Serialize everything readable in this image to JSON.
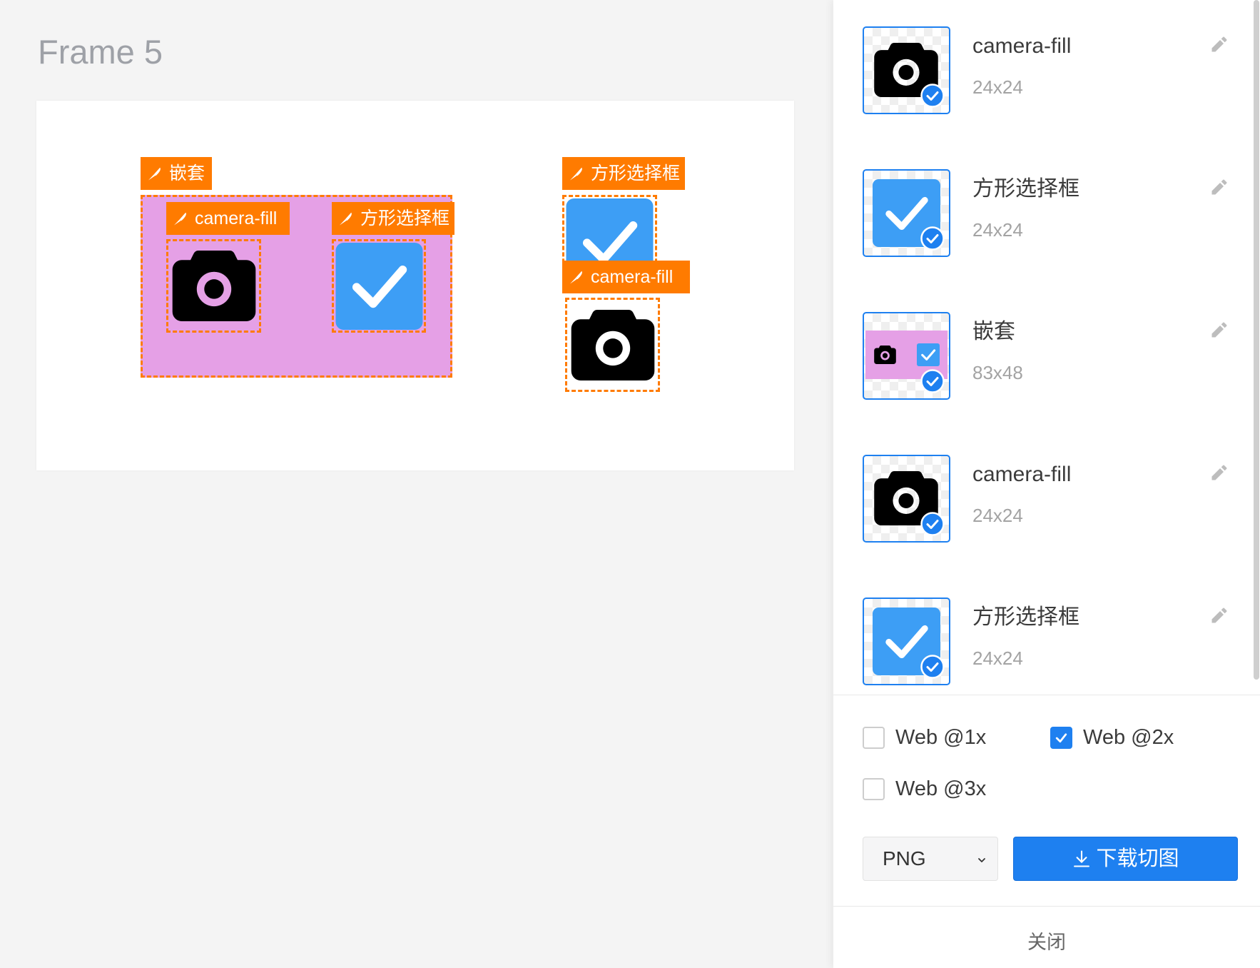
{
  "canvas": {
    "frame_title": "Frame 5",
    "slices": [
      {
        "label": "嵌套"
      },
      {
        "label": "camera-fill"
      },
      {
        "label": "方形选择框"
      },
      {
        "label": "方形选择框"
      },
      {
        "label": "camera-fill"
      }
    ]
  },
  "panel": {
    "assets": [
      {
        "name": "camera-fill",
        "size": "24x24",
        "thumb_icon": "camera-fill-icon",
        "selected": true
      },
      {
        "name": "方形选择框",
        "size": "24x24",
        "thumb_icon": "checkbox-checked-icon",
        "selected": true
      },
      {
        "name": "嵌套",
        "size": "83x48",
        "thumb_icon": "nested-group-thumbnail",
        "selected": true
      },
      {
        "name": "camera-fill",
        "size": "24x24",
        "thumb_icon": "camera-fill-icon",
        "selected": true
      },
      {
        "name": "方形选择框",
        "size": "24x24",
        "thumb_icon": "checkbox-checked-icon",
        "selected": true
      }
    ],
    "export_options": [
      {
        "label": "Web @1x",
        "checked": false
      },
      {
        "label": "Web @2x",
        "checked": true
      },
      {
        "label": "Web @3x",
        "checked": false
      }
    ],
    "format_select": {
      "value": "PNG"
    },
    "download_button": {
      "label": "下载切图"
    },
    "close_button": {
      "label": "关闭"
    }
  },
  "icons": {
    "slice_label": "scalpel-icon",
    "asset_edit": "pencil-icon",
    "selected_badge": "check-circle-icon",
    "select_arrow": "chevron-down-icon",
    "download": "download-icon"
  },
  "colors": {
    "accent_blue": "#1e80f0",
    "slice_orange": "#ff7b00",
    "nested_pink": "#e5a0e6",
    "checkbox_blue": "#3d9ef5",
    "camera_black": "#000000"
  }
}
